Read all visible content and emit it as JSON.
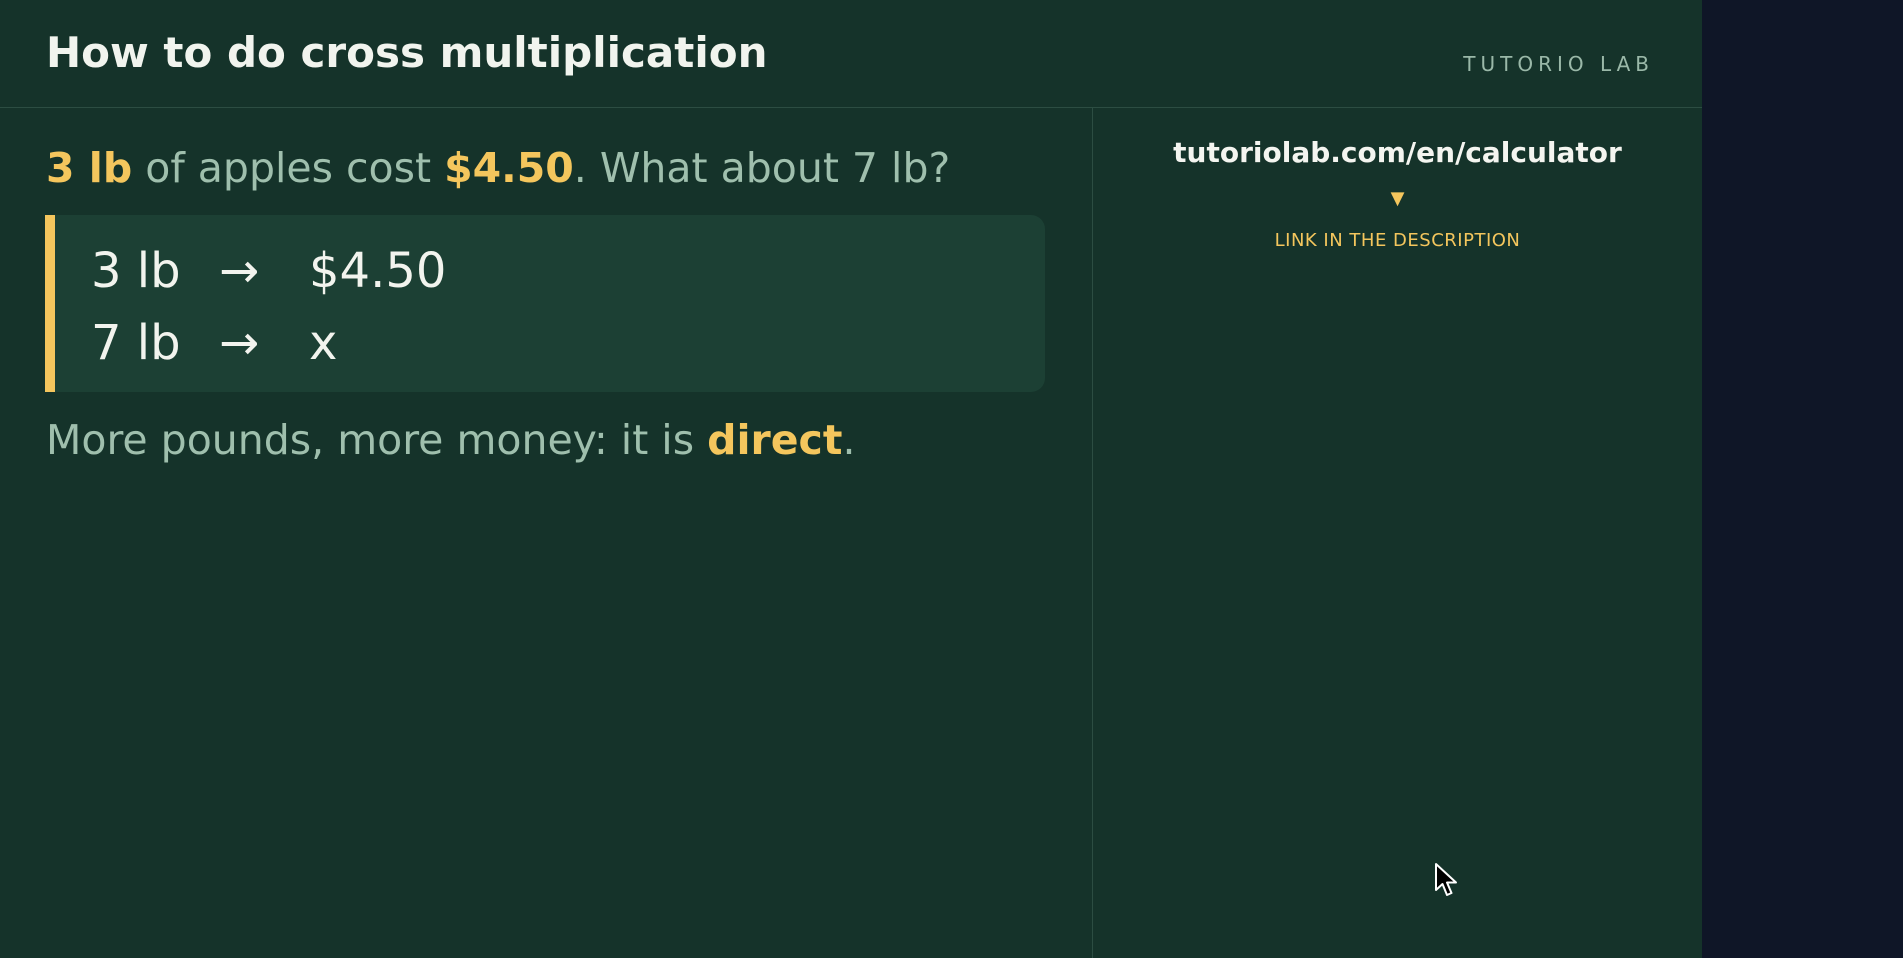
{
  "header": {
    "title": "How to do cross multiplication",
    "brand": "TUTORIO LAB"
  },
  "problem": {
    "qty": "3 lb",
    "text1": " of apples cost ",
    "price": "$4.50",
    "text2": ". What about 7 lb?"
  },
  "card": {
    "row1": {
      "qty": "3 lb",
      "arrow": "→",
      "value": "$4.50"
    },
    "row2": {
      "qty": "7 lb",
      "arrow": "→",
      "value": "x"
    }
  },
  "conclusion": {
    "text1": "More pounds, more money: it is ",
    "keyword": "direct",
    "text2": "."
  },
  "sidebar": {
    "url": "tutoriolab.com/en/calculator",
    "pointer": "▼",
    "caption": "LINK IN THE DESCRIPTION"
  },
  "colors": {
    "background": "#15332a",
    "accent": "#f4c65d",
    "muted_text": "#9fbfad",
    "card": "#1c4034"
  },
  "icons": {
    "cursor": "mouse-pointer-icon"
  }
}
